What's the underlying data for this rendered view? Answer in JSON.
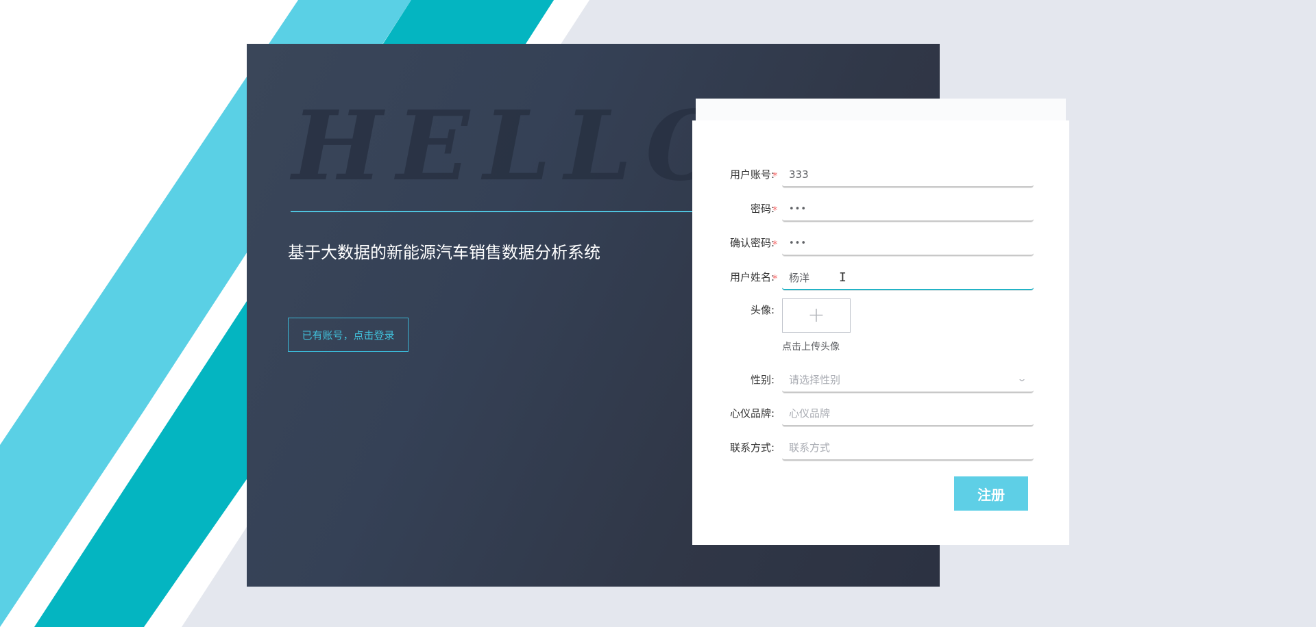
{
  "colors": {
    "accent": "#5ecfe6",
    "teal_stripe": "#04b5c1",
    "light_stripe": "#5ad0e5",
    "dark_panel": "#333c4e",
    "required_star": "#f56c6c",
    "page_bg": "#e4e7ee"
  },
  "hero": {
    "hello_text": "HELLO",
    "system_title": "基于大数据的新能源汽车销售数据分析系统",
    "login_link": "已有账号，点击登录"
  },
  "form": {
    "account": {
      "label": "用户账号:",
      "required": "*",
      "value": "333"
    },
    "password": {
      "label": "密码:",
      "required": "*",
      "value": "•••"
    },
    "confirm_password": {
      "label": "确认密码:",
      "required": "*",
      "value": "•••"
    },
    "real_name": {
      "label": "用户姓名:",
      "required": "*",
      "value": "杨洋"
    },
    "avatar": {
      "label": "头像:",
      "upload_icon": "plus-icon",
      "tip": "点击上传头像"
    },
    "gender": {
      "label": "性别:",
      "placeholder": "请选择性别",
      "icon": "chevron-down-icon"
    },
    "favorite_brand": {
      "label": "心仪品牌:",
      "placeholder": "心仪品牌"
    },
    "contact": {
      "label": "联系方式:",
      "placeholder": "联系方式"
    },
    "submit_label": "注册"
  }
}
